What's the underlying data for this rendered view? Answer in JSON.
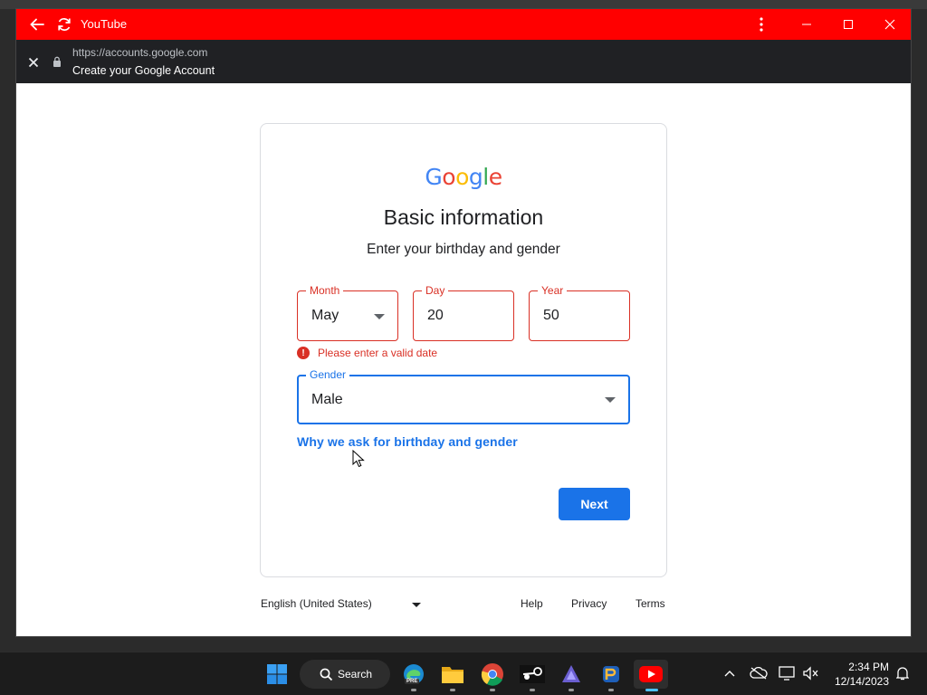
{
  "window": {
    "app_title": "YouTube",
    "url": "https://accounts.google.com",
    "page_title": "Create your Google Account",
    "title_color": "#ff0000"
  },
  "form": {
    "logo_text": "Google",
    "heading": "Basic information",
    "subheading": "Enter your birthday and gender",
    "month": {
      "label": "Month",
      "value": "May"
    },
    "day": {
      "label": "Day",
      "value": "20"
    },
    "year": {
      "label": "Year",
      "value": "50"
    },
    "error": "Please enter a valid date",
    "gender": {
      "label": "Gender",
      "value": "Male"
    },
    "why_link": "Why we ask for birthday and gender",
    "next_label": "Next",
    "error_color": "#d93025",
    "accent_color": "#1a73e8"
  },
  "footer": {
    "language": "English (United States)",
    "help": "Help",
    "privacy": "Privacy",
    "terms": "Terms"
  },
  "taskbar": {
    "search_label": "Search",
    "edge_badge": "PRE",
    "time": "2:34 PM",
    "date": "12/14/2023"
  }
}
